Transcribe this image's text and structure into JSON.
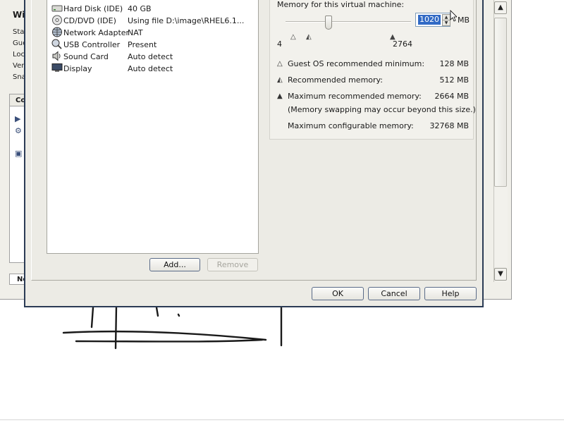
{
  "background_window": {
    "title": "Wi",
    "side_labels": [
      "Sta",
      "Gue",
      "Loc",
      "Ver",
      "Sna"
    ],
    "panel_header": "Co",
    "bottom_tab": "No"
  },
  "devices": [
    {
      "icon": "hard-disk-icon",
      "name": "Hard Disk (IDE)",
      "summary": "40 GB"
    },
    {
      "icon": "cd-dvd-icon",
      "name": "CD/DVD (IDE)",
      "summary": "Using file D:\\image\\RHEL6.1..."
    },
    {
      "icon": "network-adapter-icon",
      "name": "Network Adapter",
      "summary": "NAT"
    },
    {
      "icon": "usb-controller-icon",
      "name": "USB Controller",
      "summary": "Present"
    },
    {
      "icon": "sound-card-icon",
      "name": "Sound Card",
      "summary": "Auto detect"
    },
    {
      "icon": "display-icon",
      "name": "Display",
      "summary": "Auto detect"
    }
  ],
  "device_buttons": {
    "add": "Add...",
    "remove": "Remove"
  },
  "memory": {
    "title": "Memory for this virtual machine:",
    "value": "1020",
    "unit": "MB",
    "slider_min_label": "4",
    "slider_max_label": "2764",
    "slider_fraction": 0.37,
    "info": [
      {
        "marker": "outline-triangle",
        "label": "Guest OS recommended minimum:",
        "value": "128 MB"
      },
      {
        "marker": "half-triangle",
        "label": "Recommended memory:",
        "value": "512 MB"
      },
      {
        "marker": "filled-triangle",
        "label": "Maximum recommended memory:",
        "value": "2664 MB"
      },
      {
        "marker": "none",
        "label": "(Memory swapping may occur beyond this size.)",
        "value": ""
      },
      {
        "marker": "none",
        "label": "Maximum configurable memory:",
        "value": "32768 MB"
      }
    ]
  },
  "dialog_buttons": {
    "ok": "OK",
    "cancel": "Cancel",
    "help": "Help"
  },
  "scrollbar": {
    "up": "▲",
    "down": "▼"
  }
}
